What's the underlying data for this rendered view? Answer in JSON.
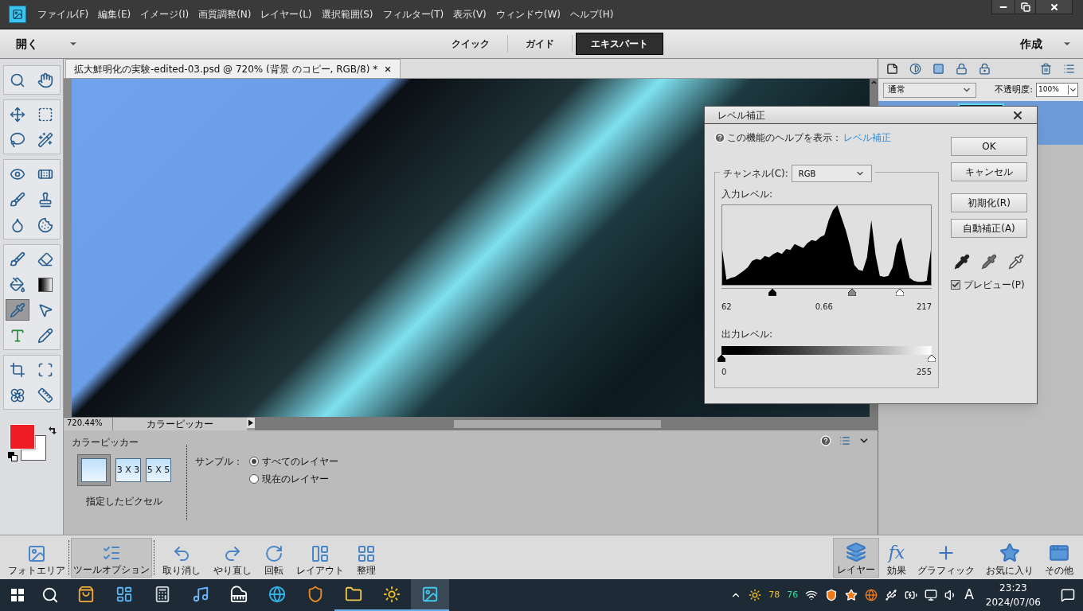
{
  "menu": [
    "ファイル(F)",
    "編集(E)",
    "イメージ(I)",
    "画質調整(N)",
    "レイヤー(L)",
    "選択範囲(S)",
    "フィルター(T)",
    "表示(V)",
    "ウィンドウ(W)",
    "ヘルプ(H)"
  ],
  "mode_bar": {
    "open": "開く",
    "modes": [
      {
        "label": "クイック",
        "selected": false
      },
      {
        "label": "ガイド",
        "selected": false
      },
      {
        "label": "エキスパート",
        "selected": true
      }
    ],
    "create": "作成"
  },
  "toolbox": {
    "groups": [
      [
        {
          "selected": false
        },
        {
          "selected": false
        }
      ],
      [
        {
          "selected": false
        },
        {
          "selected": false
        },
        {
          "selected": false
        },
        {
          "selected": false
        }
      ],
      [
        {
          "selected": false
        },
        {
          "selected": false
        },
        {
          "selected": false
        },
        {
          "selected": false
        },
        {
          "selected": false
        },
        {
          "selected": false
        }
      ],
      [
        {
          "selected": false
        },
        {
          "selected": false
        },
        {
          "selected": false
        },
        {
          "selected": false
        },
        {
          "selected": true
        },
        {
          "selected": false
        },
        {
          "selected": false
        },
        {
          "selected": false
        }
      ],
      [
        {
          "selected": false
        },
        {
          "selected": false
        },
        {
          "selected": false
        },
        {
          "selected": false
        }
      ]
    ]
  },
  "document": {
    "tab_title": "拡大鮮明化の実験-edited-03.psd @ 720% (背景 のコピー, RGB/8) *",
    "zoom": "720.44%",
    "status_info": "カラーピッカー"
  },
  "tool_options": {
    "title": "カラーピッカー",
    "sample_sizes": [
      {
        "kind": "pixel",
        "selected": true
      },
      {
        "kind": "grid",
        "label": "3 X 3",
        "selected": false
      },
      {
        "kind": "grid",
        "label": "5 X 5",
        "selected": false
      }
    ],
    "sample_size_caption": "指定したピクセル",
    "sample_label": "サンプル：",
    "sample_options": [
      {
        "label": "すべてのレイヤー",
        "selected": true
      },
      {
        "label": "現在のレイヤー",
        "selected": false
      }
    ]
  },
  "layers_panel": {
    "blend_mode": "通常",
    "opacity_label": "不透明度:",
    "opacity": "100%"
  },
  "levels_dialog": {
    "title": "レベル補正",
    "help_text": "この機能のヘルプを表示：",
    "help_link": "レベル補正",
    "channel_label": "チャンネル(C):",
    "channel": "RGB",
    "input_label": "入力レベル:",
    "input_handles": [
      {
        "kind": "black",
        "value": "62",
        "level": 0.243
      },
      {
        "kind": "gray",
        "value": "0.66",
        "level": 0.62
      },
      {
        "kind": "white",
        "value": "217",
        "level": 0.85
      }
    ],
    "output_label": "出力レベル:",
    "output_handles": [
      {
        "kind": "black",
        "value": "0",
        "level": 0
      },
      {
        "kind": "white",
        "value": "255",
        "level": 1
      }
    ],
    "buttons": [
      "OK",
      "キャンセル",
      "初期化(R)",
      "自動補正(A)"
    ],
    "preview": {
      "label": "プレビュー(P)",
      "checked": true
    }
  },
  "bottom_bar": {
    "left": [
      {
        "label": "フォトエリア",
        "selected": false
      },
      {
        "label": "ツールオプション",
        "selected": true
      },
      {
        "label": "取り消し",
        "selected": false
      },
      {
        "label": "やり直し",
        "selected": false
      },
      {
        "label": "回転",
        "selected": false
      },
      {
        "label": "レイアウト",
        "selected": false
      },
      {
        "label": "整理",
        "selected": false
      }
    ],
    "right": [
      {
        "label": "レイヤー",
        "selected": true
      },
      {
        "label": "効果",
        "selected": false,
        "icon_text": "fx"
      },
      {
        "label": "グラフィック",
        "selected": false
      },
      {
        "label": "お気に入り",
        "selected": false
      },
      {
        "label": "その他",
        "selected": false
      }
    ]
  },
  "taskbar": {
    "apps": [
      {
        "running": false,
        "selected": false
      },
      {
        "running": false,
        "selected": false
      },
      {
        "running": false,
        "selected": false
      },
      {
        "running": false,
        "selected": false
      },
      {
        "running": false,
        "selected": false
      },
      {
        "running": false,
        "selected": false
      },
      {
        "running": false,
        "selected": false
      },
      {
        "running": true,
        "selected": false
      },
      {
        "running": true,
        "selected": false
      },
      {
        "running": true,
        "selected": true
      }
    ],
    "tray_numbers": [
      {
        "text": "78",
        "color": "#f5c518"
      },
      {
        "text": "76",
        "color": "#2ee59d"
      }
    ],
    "ime": "A",
    "time": "23:23",
    "date": "2024/07/06"
  }
}
